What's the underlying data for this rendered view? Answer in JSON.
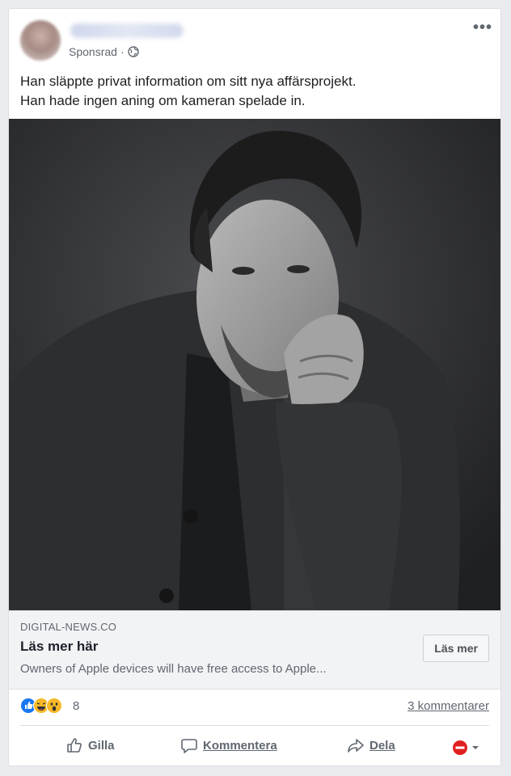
{
  "post": {
    "sponsored_label": "Sponsrad",
    "sponsored_sep": "·",
    "text_line1": "Han släppte privat information om sitt nya affärsprojekt.",
    "text_line2": "Han hade ingen aning om kameran spelade in.",
    "more_glyph": "•••"
  },
  "link": {
    "domain": "DIGITAL-NEWS.CO",
    "title": "Läs mer här",
    "description": "Owners of Apple devices will have free access to Apple...",
    "cta_label": "Läs mer"
  },
  "reactions": {
    "count": "8",
    "types": [
      "like-icon",
      "haha-icon",
      "wow-icon"
    ],
    "comments": "3 kommentarer"
  },
  "actions": {
    "like": "Gilla",
    "comment": "Kommentera",
    "share": "Dela"
  },
  "colors": {
    "like_blue": "#1877f2",
    "reaction_yellow": "#f7b928",
    "block_red": "#e02020"
  }
}
